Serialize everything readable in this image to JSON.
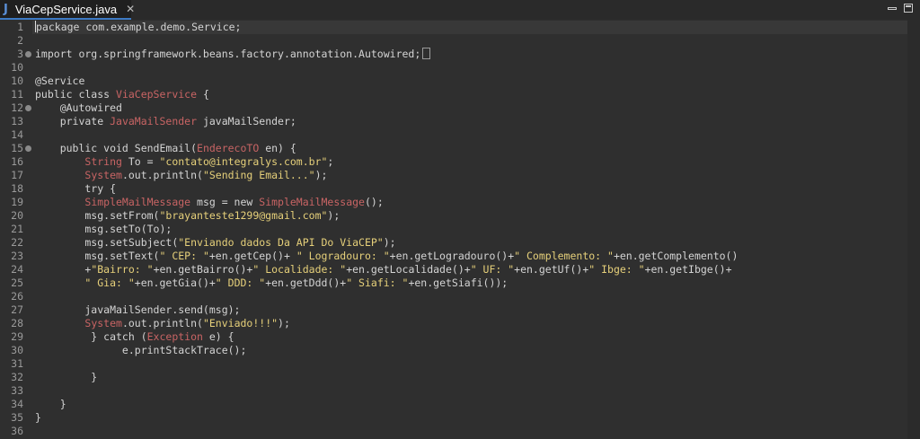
{
  "tab": {
    "icon": "J",
    "title": "ViaCepService.java",
    "close": "✕"
  },
  "window_controls": {
    "minimize": "minimize",
    "maximize": "maximize"
  },
  "lines": [
    {
      "n": "1",
      "t": "package com.example.demo.Service;"
    },
    {
      "n": "2",
      "t": ""
    },
    {
      "n": "3",
      "t": "import org.springframework.beans.factory.annotation.Autowired;"
    },
    {
      "n": "10",
      "t": ""
    },
    {
      "n": "10",
      "t": "@Service"
    },
    {
      "n": "11",
      "t": "public class ViaCepService {"
    },
    {
      "n": "12",
      "t": "    @Autowired"
    },
    {
      "n": "13",
      "t": "    private JavaMailSender javaMailSender;"
    },
    {
      "n": "14",
      "t": ""
    },
    {
      "n": "15",
      "t": "    public void SendEmail(EnderecoTO en) {"
    },
    {
      "n": "16",
      "t": "        String To = \"contato@integralys.com.br\";"
    },
    {
      "n": "17",
      "t": "        System.out.println(\"Sending Email...\");"
    },
    {
      "n": "18",
      "t": "        try {"
    },
    {
      "n": "19",
      "t": "        SimpleMailMessage msg = new SimpleMailMessage();"
    },
    {
      "n": "20",
      "t": "        msg.setFrom(\"brayanteste1299@gmail.com\");"
    },
    {
      "n": "21",
      "t": "        msg.setTo(To);"
    },
    {
      "n": "22",
      "t": "        msg.setSubject(\"Enviando dados Da API Do ViaCEP\");"
    },
    {
      "n": "23",
      "t": "        msg.setText(\" CEP: \"+en.getCep()+ \" Logradouro: \"+en.getLogradouro()+\" Complemento: \"+en.getComplemento()"
    },
    {
      "n": "24",
      "t": "        +\"Bairro: \"+en.getBairro()+\" Localidade: \"+en.getLocalidade()+\" UF: \"+en.getUf()+\" Ibge: \"+en.getIbge()+"
    },
    {
      "n": "25",
      "t": "        \" Gia: \"+en.getGia()+\" DDD: \"+en.getDdd()+\" Siafi: \"+en.getSiafi());"
    },
    {
      "n": "26",
      "t": ""
    },
    {
      "n": "27",
      "t": "        javaMailSender.send(msg);"
    },
    {
      "n": "28",
      "t": "        System.out.println(\"Enviado!!!\");"
    },
    {
      "n": "29",
      "t": "         } catch (Exception e) {"
    },
    {
      "n": "30",
      "t": "              e.printStackTrace();"
    },
    {
      "n": "31",
      "t": ""
    },
    {
      "n": "32",
      "t": "         }"
    },
    {
      "n": "33",
      "t": ""
    },
    {
      "n": "34",
      "t": "    }"
    },
    {
      "n": "35",
      "t": "}"
    },
    {
      "n": "36",
      "t": ""
    }
  ]
}
